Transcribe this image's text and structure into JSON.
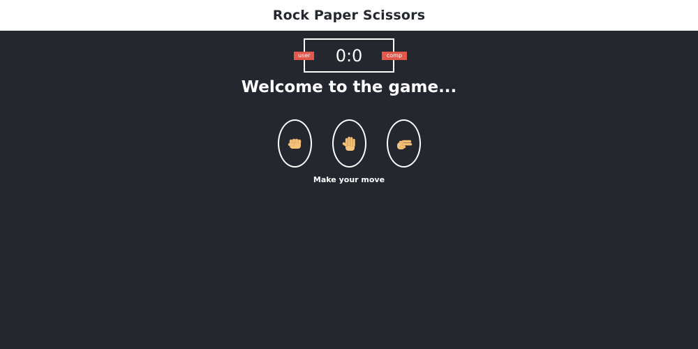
{
  "header": {
    "title": "Rock Paper Scissors"
  },
  "scoreboard": {
    "score": "0:0",
    "user_label": "user",
    "comp_label": "comp",
    "badge_color": "#e2584d"
  },
  "message": {
    "text": "Welcome to the game..."
  },
  "choices": [
    {
      "id": "rock",
      "icon": "fist-icon"
    },
    {
      "id": "paper",
      "icon": "raised-hand-icon"
    },
    {
      "id": "scissors",
      "icon": "victory-hand-icon"
    }
  ],
  "prompt": {
    "text": "Make your move"
  },
  "colors": {
    "background": "#24272e",
    "header_bg": "#ffffff",
    "skin": "#f5c27a"
  }
}
